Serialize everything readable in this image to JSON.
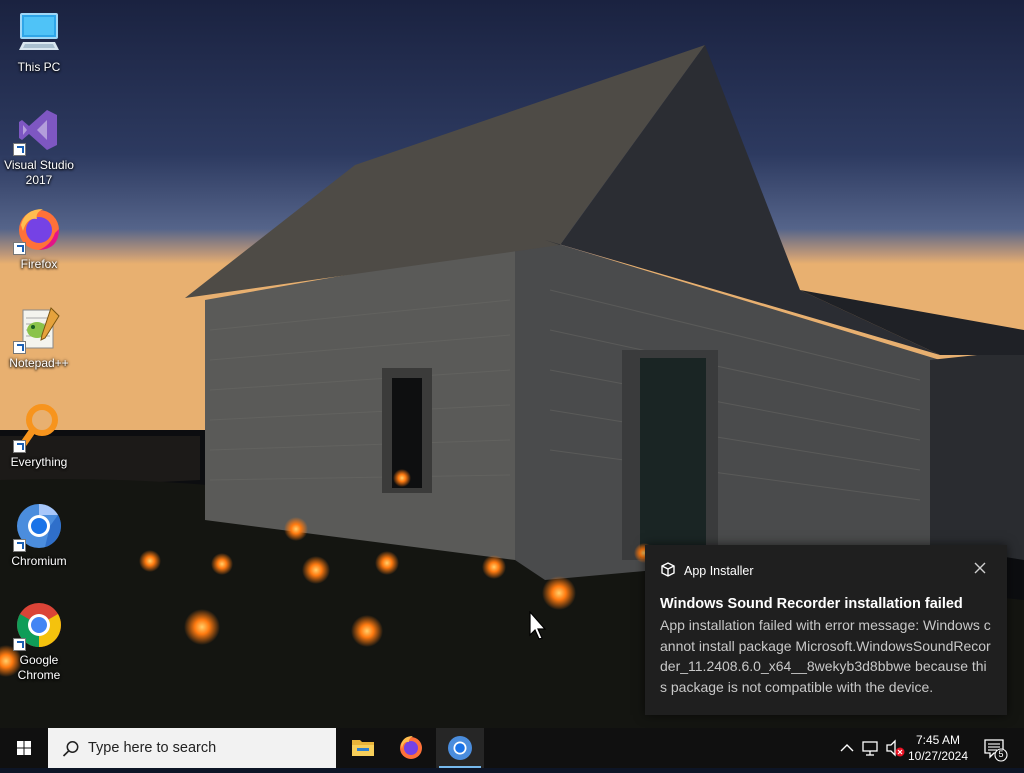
{
  "desktop": {
    "icons": [
      {
        "label": "This PC",
        "icon": "this-pc-icon",
        "shortcut": false
      },
      {
        "label": "Visual Studio 2017",
        "icon": "visual-studio-icon",
        "shortcut": true
      },
      {
        "label": "Firefox",
        "icon": "firefox-icon",
        "shortcut": true
      },
      {
        "label": "Notepad++",
        "icon": "notepad-plus-plus-icon",
        "shortcut": true
      },
      {
        "label": "Everything",
        "icon": "everything-search-icon",
        "shortcut": true
      },
      {
        "label": "Chromium",
        "icon": "chromium-icon",
        "shortcut": true
      },
      {
        "label": "Google Chrome",
        "icon": "google-chrome-icon",
        "shortcut": true
      }
    ]
  },
  "notification": {
    "app_name": "App Installer",
    "app_icon": "app-installer-icon",
    "title": "Windows Sound Recorder installation failed",
    "body": "App installation failed with error message: Windows cannot install package Microsoft.WindowsSoundRecorder_11.2408.6.0_x64__8wekyb3d8bbwe because this package is not compatible with the device.",
    "close_icon": "close-icon"
  },
  "taskbar": {
    "search_placeholder": "Type here to search",
    "pinned": [
      {
        "name": "file-explorer",
        "icon": "folder-icon",
        "active": false
      },
      {
        "name": "firefox",
        "icon": "firefox-icon",
        "active": false
      },
      {
        "name": "chromium",
        "icon": "chromium-icon",
        "active": true
      }
    ],
    "clock": {
      "time": "7:45 AM",
      "date": "10/27/2024"
    },
    "notification_count": "5",
    "colors": {
      "taskbar_bg": "#101010",
      "active_indicator": "#76b9ed",
      "toast_bg": "#1f1f1f"
    }
  }
}
